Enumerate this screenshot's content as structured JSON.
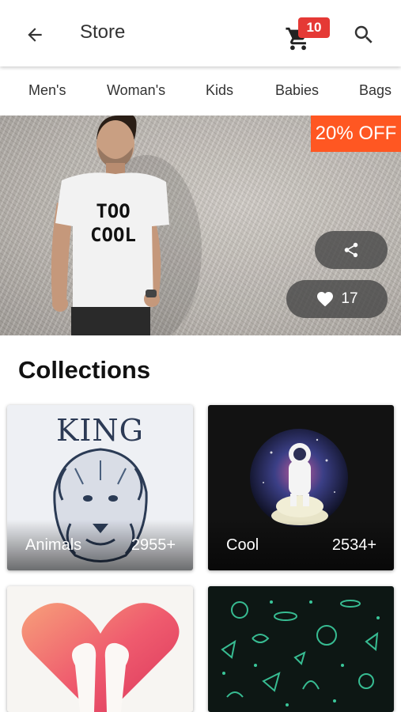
{
  "appbar": {
    "title": "Store",
    "cart_count": "10"
  },
  "tabs": [
    "Men's",
    "Woman's",
    "Kids",
    "Babies",
    "Bags"
  ],
  "banner": {
    "sale_label": "20% OFF",
    "shirt_text_line1": "TOO",
    "shirt_text_line2": "COOL",
    "likes": "17"
  },
  "collections": {
    "heading": "Collections",
    "items": [
      {
        "label": "Animals",
        "count": "2955+",
        "art_text": "KING"
      },
      {
        "label": "Cool",
        "count": "2534+"
      },
      {
        "label": "",
        "count": ""
      },
      {
        "label": "",
        "count": ""
      }
    ]
  },
  "colors": {
    "accent": "#ff5722",
    "badge": "#e53935"
  }
}
